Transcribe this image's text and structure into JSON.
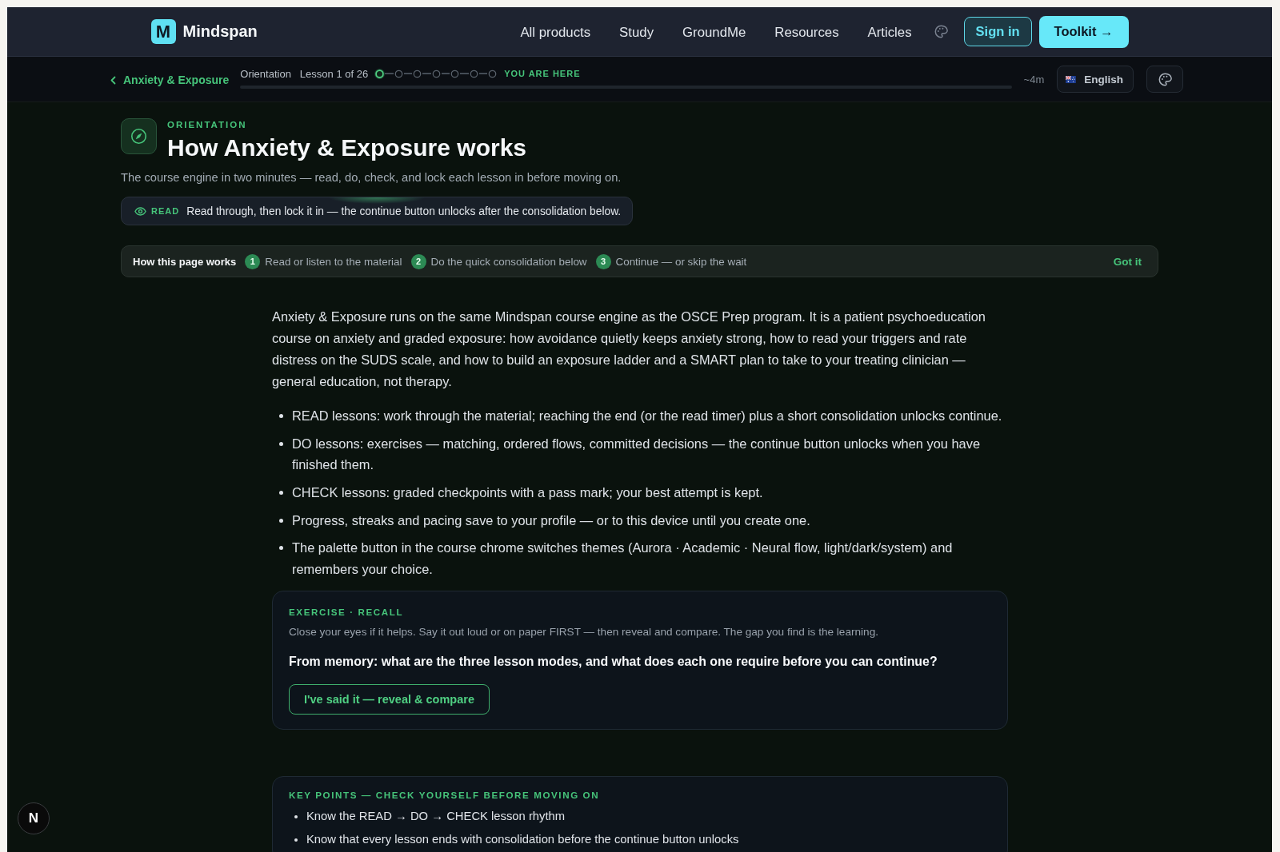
{
  "nav": {
    "logo_letter": "M",
    "brand": "Mindspan",
    "links": [
      "All products",
      "Study",
      "GroundMe",
      "Resources",
      "Articles"
    ],
    "sign_in": "Sign in",
    "cta": "Toolkit →"
  },
  "lesson_bar": {
    "back_link": "Anxiety & Exposure",
    "section": "Orientation",
    "lesson_count": "Lesson 1 of 26",
    "steps": [
      {
        "current": true
      },
      {
        "current": false
      },
      {
        "current": false
      },
      {
        "current": false
      },
      {
        "current": false
      },
      {
        "current": false
      },
      {
        "current": false
      }
    ],
    "step_caption": "YOU ARE HERE",
    "duration": "~4m",
    "language": "English"
  },
  "header": {
    "eyebrow": "ORIENTATION",
    "title": "How Anxiety & Exposure works",
    "subtitle": "The course engine in two minutes — read, do, check, and lock each lesson in before moving on.",
    "mode": {
      "label": "READ",
      "text": "Read through, then lock it in — the continue button unlocks after the consolidation below."
    }
  },
  "how_it_works": {
    "title": "How this page works",
    "steps": [
      {
        "number": "1",
        "text": "Read or listen to the material"
      },
      {
        "number": "2",
        "text": "Do the quick consolidation below"
      },
      {
        "number": "3",
        "text": "Continue — or skip the wait"
      }
    ],
    "dismiss": "Got it"
  },
  "intro": "Anxiety & Exposure runs on the same Mindspan course engine as the OSCE Prep program. It is a patient psychoeducation course on anxiety and graded exposure: how avoidance quietly keeps anxiety strong, how to read your triggers and rate distress on the SUDS scale, and how to build an exposure ladder and a SMART plan to take to your treating clinician — general education, not therapy.",
  "bullets": [
    "READ lessons: work through the material; reaching the end (or the read timer) plus a short consolidation unlocks continue.",
    "DO lessons: exercises — matching, ordered flows, committed decisions — the continue button unlocks when you have finished them.",
    "CHECK lessons: graded checkpoints with a pass mark; your best attempt is kept.",
    "Progress, streaks and pacing save to your profile — or to this device until you create one.",
    "The palette button in the course chrome switches themes (Aurora · Academic · Neural flow, light/dark/system) and remembers your choice."
  ],
  "exercise": {
    "eyebrow": "EXERCISE · RECALL",
    "hint": "Close your eyes if it helps. Say it out loud or on paper FIRST — then reveal and compare. The gap you find is the learning.",
    "question": "From memory: what are the three lesson modes, and what does each one require before you can continue?",
    "button": "I've said it — reveal & compare"
  },
  "key_points": {
    "heading": "KEY POINTS — CHECK YOURSELF BEFORE MOVING ON",
    "items": [
      "Know the READ → DO → CHECK lesson rhythm",
      "Know that every lesson ends with consolidation before the continue button unlocks"
    ]
  },
  "dev_badge": "N"
}
